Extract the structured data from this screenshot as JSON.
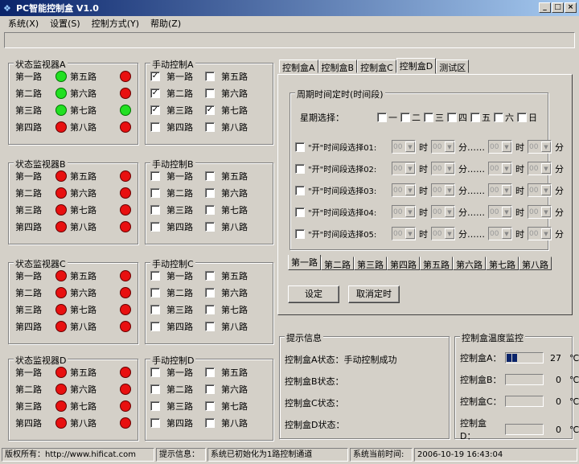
{
  "window": {
    "title": "PC智能控制盒 V1.0",
    "buttons": [
      "_",
      "□",
      "×"
    ]
  },
  "menu": [
    "系统(X)",
    "设置(S)",
    "控制方式(Y)",
    "帮助(Z)"
  ],
  "monitors": [
    {
      "title": "状态监视器A",
      "channels": [
        {
          "label": "第一路",
          "on": true
        },
        {
          "label": "第二路",
          "on": true
        },
        {
          "label": "第三路",
          "on": true
        },
        {
          "label": "第四路",
          "on": false
        },
        {
          "label": "第五路",
          "on": false
        },
        {
          "label": "第六路",
          "on": false
        },
        {
          "label": "第七路",
          "on": true
        },
        {
          "label": "第八路",
          "on": false
        }
      ]
    },
    {
      "title": "状态监视器B",
      "channels": [
        {
          "label": "第一路",
          "on": false
        },
        {
          "label": "第二路",
          "on": false
        },
        {
          "label": "第三路",
          "on": false
        },
        {
          "label": "第四路",
          "on": false
        },
        {
          "label": "第五路",
          "on": false
        },
        {
          "label": "第六路",
          "on": false
        },
        {
          "label": "第七路",
          "on": false
        },
        {
          "label": "第八路",
          "on": false
        }
      ]
    },
    {
      "title": "状态监视器C",
      "channels": [
        {
          "label": "第一路",
          "on": false
        },
        {
          "label": "第二路",
          "on": false
        },
        {
          "label": "第三路",
          "on": false
        },
        {
          "label": "第四路",
          "on": false
        },
        {
          "label": "第五路",
          "on": false
        },
        {
          "label": "第六路",
          "on": false
        },
        {
          "label": "第七路",
          "on": false
        },
        {
          "label": "第八路",
          "on": false
        }
      ]
    },
    {
      "title": "状态监视器D",
      "channels": [
        {
          "label": "第一路",
          "on": false
        },
        {
          "label": "第二路",
          "on": false
        },
        {
          "label": "第三路",
          "on": false
        },
        {
          "label": "第四路",
          "on": false
        },
        {
          "label": "第五路",
          "on": false
        },
        {
          "label": "第六路",
          "on": false
        },
        {
          "label": "第七路",
          "on": false
        },
        {
          "label": "第八路",
          "on": false
        }
      ]
    }
  ],
  "manual": [
    {
      "title": "手动控制A",
      "channels": [
        {
          "label": "第一路",
          "checked": true
        },
        {
          "label": "第二路",
          "checked": true
        },
        {
          "label": "第三路",
          "checked": true
        },
        {
          "label": "第四路",
          "checked": false
        },
        {
          "label": "第五路",
          "checked": false
        },
        {
          "label": "第六路",
          "checked": false
        },
        {
          "label": "第七路",
          "checked": true
        },
        {
          "label": "第八路",
          "checked": false
        }
      ]
    },
    {
      "title": "手动控制B",
      "channels": [
        {
          "label": "第一路",
          "checked": false
        },
        {
          "label": "第二路",
          "checked": false
        },
        {
          "label": "第三路",
          "checked": false
        },
        {
          "label": "第四路",
          "checked": false
        },
        {
          "label": "第五路",
          "checked": false
        },
        {
          "label": "第六路",
          "checked": false
        },
        {
          "label": "第七路",
          "checked": false
        },
        {
          "label": "第八路",
          "checked": false
        }
      ]
    },
    {
      "title": "手动控制C",
      "channels": [
        {
          "label": "第一路",
          "checked": false
        },
        {
          "label": "第二路",
          "checked": false
        },
        {
          "label": "第三路",
          "checked": false
        },
        {
          "label": "第四路",
          "checked": false
        },
        {
          "label": "第五路",
          "checked": false
        },
        {
          "label": "第六路",
          "checked": false
        },
        {
          "label": "第七路",
          "checked": false
        },
        {
          "label": "第八路",
          "checked": false
        }
      ]
    },
    {
      "title": "手动控制D",
      "channels": [
        {
          "label": "第一路",
          "checked": false
        },
        {
          "label": "第二路",
          "checked": false
        },
        {
          "label": "第三路",
          "checked": false
        },
        {
          "label": "第四路",
          "checked": false
        },
        {
          "label": "第五路",
          "checked": false
        },
        {
          "label": "第六路",
          "checked": false
        },
        {
          "label": "第七路",
          "checked": false
        },
        {
          "label": "第八路",
          "checked": false
        }
      ]
    }
  ],
  "tabs": {
    "items": [
      "控制盒A",
      "控制盒B",
      "控制盒C",
      "控制盒D",
      "测试区"
    ],
    "active": 3
  },
  "timer": {
    "group_title": "周期时间定时(时间段)",
    "week_label": "星期选择：",
    "days": [
      "一",
      "二",
      "三",
      "四",
      "五",
      "六",
      "日"
    ],
    "slots": [
      "\"开\"时间段选择01:",
      "\"开\"时间段选择02:",
      "\"开\"时间段选择03:",
      "\"开\"时间段选择04:",
      "\"开\"时间段选择05:"
    ],
    "value": "00",
    "hour": "时",
    "minute": "分",
    "dash": "分……"
  },
  "channel_tabs": {
    "items": [
      "第一路",
      "第二路",
      "第三路",
      "第四路",
      "第五路",
      "第六路",
      "第七路",
      "第八路"
    ],
    "active": 0
  },
  "buttons": {
    "set": "设定",
    "cancel": "取消定时"
  },
  "info": {
    "title": "提示信息",
    "lines": [
      "控制盒A状态：手动控制成功",
      "控制盒B状态：",
      "控制盒C状态：",
      "控制盒D状态："
    ]
  },
  "temp": {
    "title": "控制盒温度监控",
    "unit": "℃",
    "rows": [
      {
        "label": "控制盒A：",
        "value": "27",
        "blocks": 2
      },
      {
        "label": "控制盒B：",
        "value": "0",
        "blocks": 0
      },
      {
        "label": "控制盒C：",
        "value": "0",
        "blocks": 0
      },
      {
        "label": "控制盒D：",
        "value": "0",
        "blocks": 0
      }
    ]
  },
  "status": {
    "copyright": "版权所有：http://www.hificat.com",
    "hint_label": "提示信息：",
    "hint": "系统已初始化为1路控制通道",
    "time_label": "系统当前时间:",
    "time": "2006-10-19 16:43:04"
  }
}
